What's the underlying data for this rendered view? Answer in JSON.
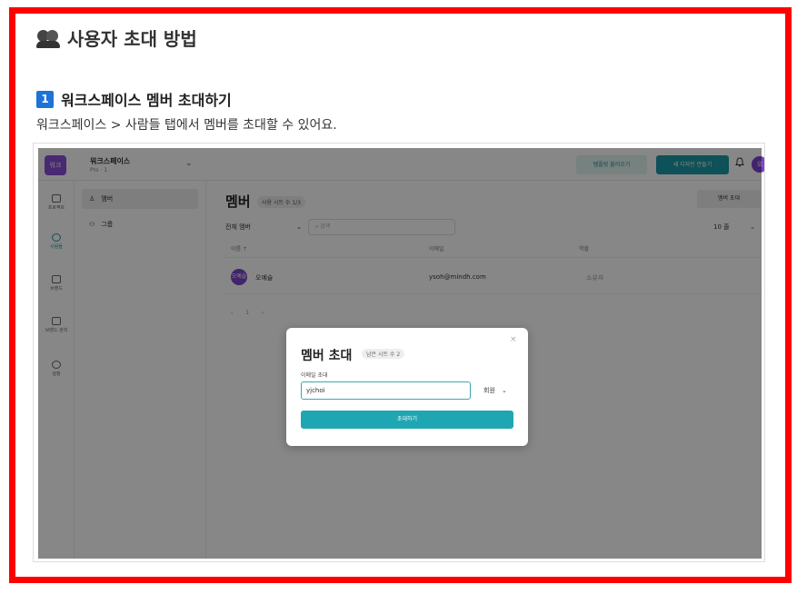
{
  "doc": {
    "title": "사용자 초대 방법",
    "section_number": "1",
    "section_title": "워크스페이스 멤버 초대하기",
    "description": "워크스페이스 > 사람들 탭에서 멤버를 초대할 수 있어요."
  },
  "app": {
    "workspace": {
      "logo": "워크",
      "name": "워크스페이스",
      "plan": "Pro · 1"
    },
    "topbar": {
      "template_button": "템플릿 불러오기",
      "new_button": "새 디자인 만들기",
      "avatar": "오"
    },
    "nav": [
      {
        "label": "프로젝트",
        "icon": "folder-icon"
      },
      {
        "label": "사람들",
        "icon": "people-icon"
      },
      {
        "label": "브랜드",
        "icon": "brand-icon"
      },
      {
        "label": "브랜드 관리",
        "icon": "brand-manage-icon"
      },
      {
        "label": "설정",
        "icon": "gear-icon"
      }
    ],
    "sub_nav": [
      {
        "label": "멤버",
        "icon": "person-icon"
      },
      {
        "label": "그룹",
        "icon": "group-icon"
      }
    ],
    "main": {
      "title": "멤버",
      "seat_badge": "사용 시트 수 1/3",
      "invite_button": "멤버 초대",
      "filter": "전체 멤버",
      "search_placeholder": "검색",
      "per_page": "10 줄",
      "columns": [
        "이름 ↑",
        "이메일",
        "역할"
      ],
      "row": {
        "avatar": "오예슬",
        "name": "오예슬",
        "email": "ysoh@mindh.com",
        "role": "소유자"
      },
      "pager": "‹ 1 ›"
    },
    "modal": {
      "title": "멤버 초대",
      "badge": "남은 시트 수 2",
      "close": "×",
      "email_label": "이메일 초대",
      "email_value": "yjchoi",
      "role": "회원",
      "submit": "초대하기"
    }
  },
  "colors": {
    "frame": "#ff0000",
    "accent": "#1fa6b3",
    "avatar": "#7b44c8",
    "badge": "#1e73d8"
  }
}
